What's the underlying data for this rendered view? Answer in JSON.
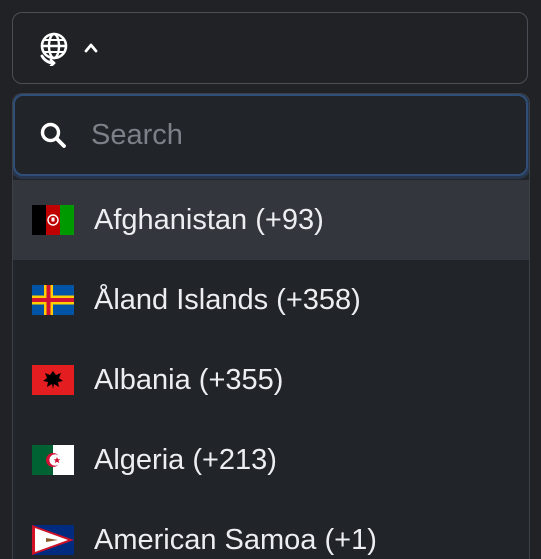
{
  "trigger": {
    "icon": "globe-icon",
    "chevron": "chevron-up-icon"
  },
  "search": {
    "placeholder": "Search",
    "value": "",
    "icon": "search-icon"
  },
  "countries": [
    {
      "label": "Afghanistan (+93)",
      "flag": "af",
      "active": true
    },
    {
      "label": "Åland Islands (+358)",
      "flag": "ax",
      "active": false
    },
    {
      "label": "Albania (+355)",
      "flag": "al",
      "active": false
    },
    {
      "label": "Algeria (+213)",
      "flag": "dz",
      "active": false
    },
    {
      "label": "American Samoa (+1)",
      "flag": "as",
      "active": false
    }
  ],
  "colors": {
    "background": "#202226",
    "focus_ring": "#2f4e78",
    "active_row": "#33363c",
    "text": "#eceef1",
    "placeholder": "#7c8088"
  }
}
